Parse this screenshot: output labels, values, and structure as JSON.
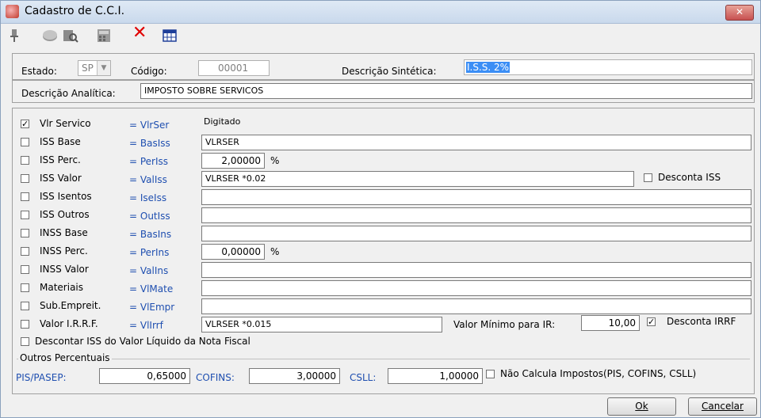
{
  "window": {
    "title": "Cadastro de C.C.I.",
    "close_glyph": "✕"
  },
  "toolbar": {
    "icons": [
      "pin-icon",
      "disk-icon",
      "search-icon",
      "calculator-icon",
      "delete-icon",
      "grid-icon"
    ],
    "delete_glyph": "✕"
  },
  "header": {
    "estado_label": "Estado:",
    "estado_value": "SP",
    "codigo_label": "Código:",
    "codigo_value": "00001",
    "desc_sint_label": "Descrição Sintética:",
    "desc_sint_value": "I.S.S. 2%",
    "desc_anal_label": "Descrição Analítica:",
    "desc_anal_value": "IMPOSTO SOBRE SERVICOS"
  },
  "rows": [
    {
      "label": "Vlr Servico",
      "var": "= VlrSer",
      "checked": true,
      "value": "Digitado"
    },
    {
      "label": "ISS Base",
      "var": "= BasIss",
      "checked": false,
      "value": "VLRSER"
    },
    {
      "label": "ISS Perc.",
      "var": "= PerIss",
      "checked": false,
      "value": "2,00000",
      "suffix": "%"
    },
    {
      "label": "ISS Valor",
      "var": "= ValIss",
      "checked": false,
      "value": "VLRSER *0.02"
    },
    {
      "label": "ISS Isentos",
      "var": "= IseIss",
      "checked": false,
      "value": ""
    },
    {
      "label": "ISS Outros",
      "var": "= OutIss",
      "checked": false,
      "value": ""
    },
    {
      "label": "INSS Base",
      "var": "= BasIns",
      "checked": false,
      "value": ""
    },
    {
      "label": "INSS Perc.",
      "var": "= PerIns",
      "checked": false,
      "value": "0,00000",
      "suffix": "%"
    },
    {
      "label": "INSS Valor",
      "var": "= ValIns",
      "checked": false,
      "value": ""
    },
    {
      "label": "Materiais",
      "var": "= VlMate",
      "checked": false,
      "value": ""
    },
    {
      "label": "Sub.Empreit.",
      "var": "= VlEmpr",
      "checked": false,
      "value": ""
    },
    {
      "label": "Valor I.R.R.F.",
      "var": "= VlIrrf",
      "checked": false,
      "value": "VLRSER *0.015"
    }
  ],
  "desconta_iss": {
    "label": "Desconta ISS",
    "checked": false
  },
  "valor_minimo": {
    "label": "Valor Mínimo para IR:",
    "value": "10,00"
  },
  "desconta_irrf": {
    "label": "Desconta IRRF",
    "checked": true
  },
  "descontar_iss_liquido": {
    "label": "Descontar ISS do Valor Líquido da Nota Fiscal",
    "checked": false
  },
  "outros": {
    "legend": "Outros Percentuais",
    "pis_label": "PIS/PASEP:",
    "pis_value": "0,65000",
    "cofins_label": "COFINS:",
    "cofins_value": "3,00000",
    "csll_label": "CSLL:",
    "csll_value": "1,00000",
    "nao_calcula_label": "Não Calcula Impostos(PIS, COFINS, CSLL)",
    "nao_calcula_checked": false
  },
  "buttons": {
    "ok": "Ok",
    "cancel": "Cancelar"
  },
  "check_glyph": "✓"
}
